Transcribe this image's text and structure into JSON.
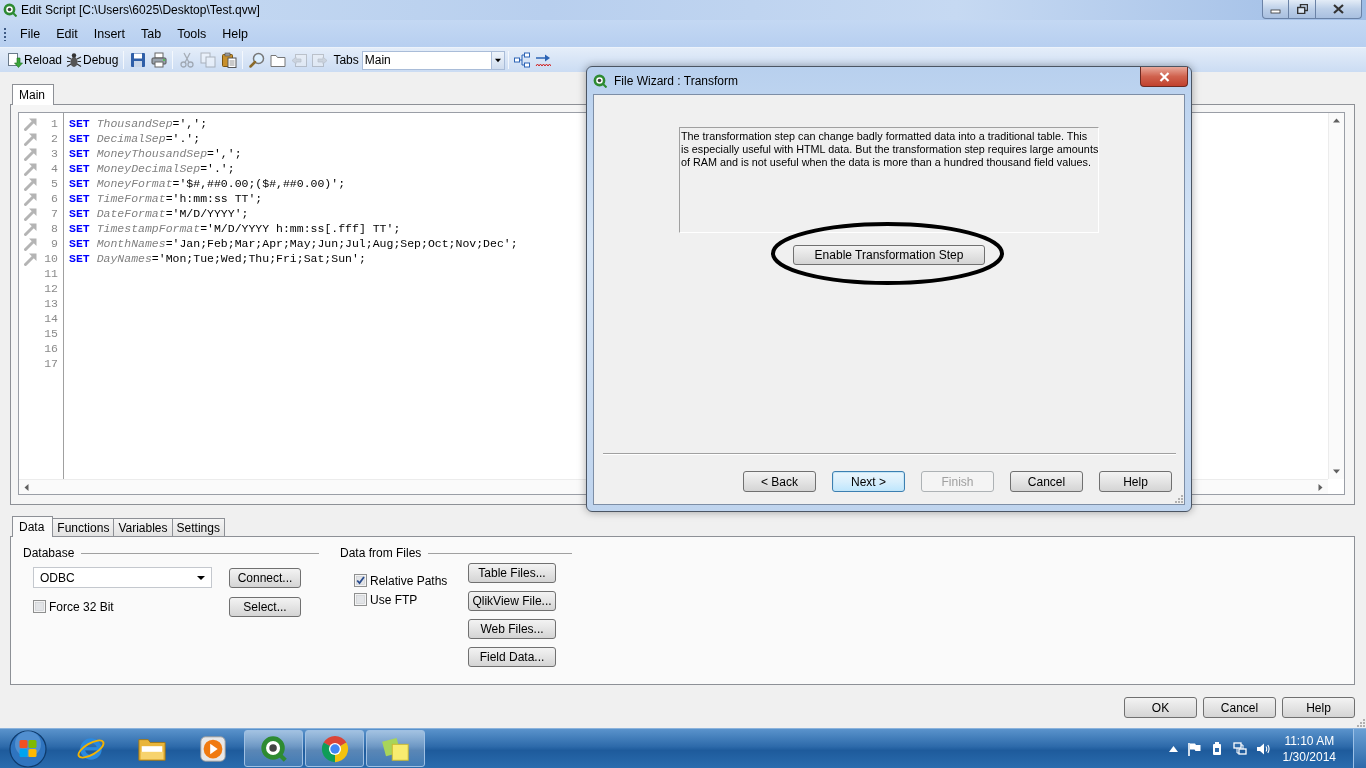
{
  "window": {
    "title": "Edit Script [C:\\Users\\6025\\Desktop\\Test.qvw]"
  },
  "menu": [
    "File",
    "Edit",
    "Insert",
    "Tab",
    "Tools",
    "Help"
  ],
  "toolbar": {
    "groups": [
      [
        {
          "kind": "reload",
          "label": "Reload",
          "disabled": false
        },
        {
          "kind": "debug",
          "label": "Debug",
          "disabled": false
        }
      ],
      [
        {
          "kind": "save",
          "disabled": false
        },
        {
          "kind": "print",
          "disabled": false
        }
      ],
      [
        {
          "kind": "cut",
          "disabled": true
        },
        {
          "kind": "copy",
          "disabled": true
        },
        {
          "kind": "paste",
          "disabled": false
        }
      ],
      [
        {
          "kind": "find",
          "disabled": false
        },
        {
          "kind": "folder",
          "disabled": false
        },
        {
          "kind": "tab-back",
          "disabled": true
        },
        {
          "kind": "tab-forward",
          "disabled": true
        }
      ]
    ],
    "tabs_label": "Tabs",
    "tabs_dropdown": "Main",
    "extra": [
      {
        "kind": "hierarchy",
        "disabled": false
      },
      {
        "kind": "syntax-check",
        "disabled": false
      }
    ]
  },
  "editor_tabs": [
    {
      "label": "Main",
      "selected": true
    }
  ],
  "code_lines": [
    {
      "number": "1",
      "marker": true,
      "keyword": "SET",
      "name": "ThousandSep",
      "value": "=',';"
    },
    {
      "number": "2",
      "marker": true,
      "keyword": "SET",
      "name": "DecimalSep",
      "value": "='.';"
    },
    {
      "number": "3",
      "marker": true,
      "keyword": "SET",
      "name": "MoneyThousandSep",
      "value": "=',';"
    },
    {
      "number": "4",
      "marker": true,
      "keyword": "SET",
      "name": "MoneyDecimalSep",
      "value": "='.';"
    },
    {
      "number": "5",
      "marker": true,
      "keyword": "SET",
      "name": "MoneyFormat",
      "value": "='$#,##0.00;($#,##0.00)';"
    },
    {
      "number": "6",
      "marker": true,
      "keyword": "SET",
      "name": "TimeFormat",
      "value": "='h:mm:ss TT';"
    },
    {
      "number": "7",
      "marker": true,
      "keyword": "SET",
      "name": "DateFormat",
      "value": "='M/D/YYYY';"
    },
    {
      "number": "8",
      "marker": true,
      "keyword": "SET",
      "name": "TimestampFormat",
      "value": "='M/D/YYYY h:mm:ss[.fff] TT';"
    },
    {
      "number": "9",
      "marker": true,
      "keyword": "SET",
      "name": "MonthNames",
      "value": "='Jan;Feb;Mar;Apr;May;Jun;Jul;Aug;Sep;Oct;Nov;Dec';"
    },
    {
      "number": "10",
      "marker": true,
      "keyword": "SET",
      "name": "DayNames",
      "value": "='Mon;Tue;Wed;Thu;Fri;Sat;Sun';"
    },
    {
      "number": "11",
      "marker": false
    },
    {
      "number": "12",
      "marker": false
    },
    {
      "number": "13",
      "marker": false
    },
    {
      "number": "14",
      "marker": false
    },
    {
      "number": "15",
      "marker": false
    },
    {
      "number": "16",
      "marker": false
    },
    {
      "number": "17",
      "marker": false
    }
  ],
  "panel_tabs": [
    {
      "label": "Data",
      "selected": true
    },
    {
      "label": "Functions",
      "selected": false
    },
    {
      "label": "Variables",
      "selected": false
    },
    {
      "label": "Settings",
      "selected": false
    }
  ],
  "database": {
    "title": "Database",
    "driver": "ODBC",
    "force_32_bit": {
      "label": "Force 32 Bit",
      "checked": false
    },
    "buttons": [
      "Connect...",
      "Select..."
    ]
  },
  "data_from_files": {
    "title": "Data from Files",
    "options": [
      {
        "label": "Relative Paths",
        "checked": true
      },
      {
        "label": "Use FTP",
        "checked": false
      }
    ],
    "buttons": [
      "Table Files...",
      "QlikView File...",
      "Web Files...",
      "Field Data..."
    ]
  },
  "dialog_buttons": [
    "OK",
    "Cancel",
    "Help"
  ],
  "wizard": {
    "title": "File Wizard : Transform",
    "description": [
      "The transformation step can change badly formatted data into a traditional table. This",
      "is especially useful with HTML data. But the transformation step requires large amounts",
      "of RAM and is not useful when the data is more than a hundred thousand field values."
    ],
    "enable_button": "Enable Transformation Step",
    "buttons": [
      {
        "label": "< Back",
        "default": false,
        "disabled": false
      },
      {
        "label": "Next >",
        "default": true,
        "disabled": false
      },
      {
        "label": "Finish",
        "default": false,
        "disabled": true
      },
      {
        "label": "Cancel",
        "default": false,
        "disabled": false
      },
      {
        "label": "Help",
        "default": false,
        "disabled": false
      }
    ]
  },
  "taskbar": {
    "apps": [
      {
        "kind": "ie",
        "running": false
      },
      {
        "kind": "explorer",
        "running": false
      },
      {
        "kind": "media",
        "running": false
      },
      {
        "kind": "qlikview",
        "running": true
      },
      {
        "kind": "chrome",
        "running": true
      },
      {
        "kind": "notes",
        "running": true
      }
    ],
    "clock": {
      "time": "11:10 AM",
      "date": "1/30/2014"
    }
  }
}
